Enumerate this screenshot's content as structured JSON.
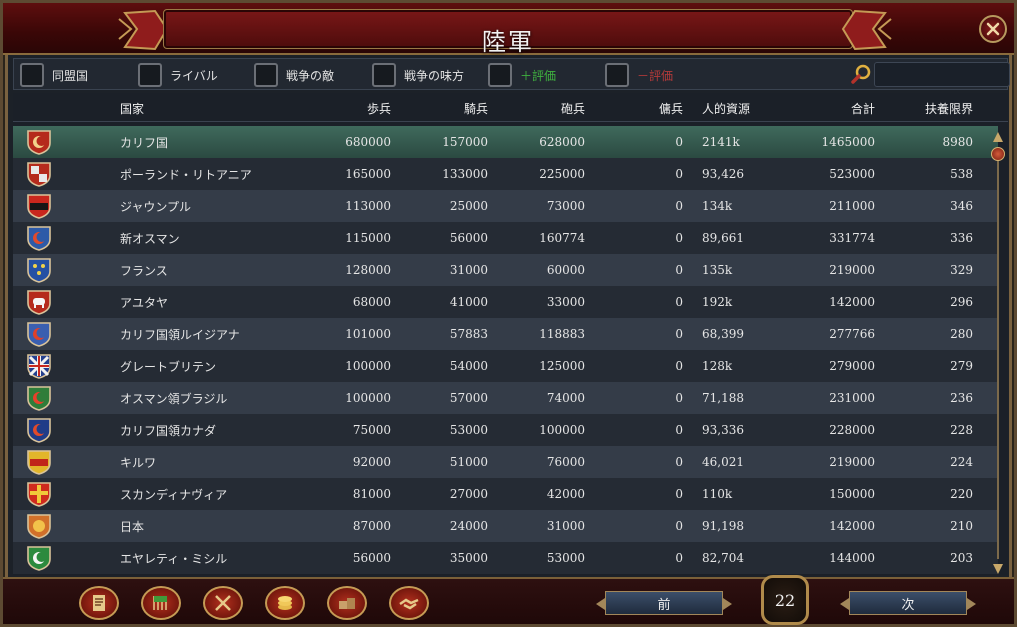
{
  "window": {
    "title": "陸軍"
  },
  "filters": [
    {
      "label": "同盟国",
      "tone": "normal"
    },
    {
      "label": "ライバル",
      "tone": "normal"
    },
    {
      "label": "戦争の敵",
      "tone": "normal"
    },
    {
      "label": "戦争の味方",
      "tone": "normal"
    },
    {
      "label": "＋評価",
      "tone": "plus"
    },
    {
      "label": "－評価",
      "tone": "minus"
    }
  ],
  "search": {
    "value": "",
    "placeholder": ""
  },
  "table": {
    "headers": {
      "country": "国家",
      "infantry": "歩兵",
      "cavalry": "騎兵",
      "artillery": "砲兵",
      "mercenaries": "傭兵",
      "manpower": "人的資源",
      "total": "合計",
      "force_limit": "扶養限界"
    },
    "rows": [
      {
        "country": "カリフ国",
        "infantry": "680000",
        "cavalry": "157000",
        "artillery": "628000",
        "mercenaries": "0",
        "manpower": "2141k",
        "total": "1465000",
        "force_limit": "8980",
        "shield": "crescent-red",
        "selected": true
      },
      {
        "country": "ポーランド・リトアニア",
        "infantry": "165000",
        "cavalry": "133000",
        "artillery": "225000",
        "mercenaries": "0",
        "manpower": "93,426",
        "total": "523000",
        "force_limit": "538",
        "shield": "quartered-red",
        "selected": false
      },
      {
        "country": "ジャウンプル",
        "infantry": "113000",
        "cavalry": "25000",
        "artillery": "73000",
        "mercenaries": "0",
        "manpower": "134k",
        "total": "211000",
        "force_limit": "346",
        "shield": "red-black",
        "selected": false
      },
      {
        "country": "新オスマン",
        "infantry": "115000",
        "cavalry": "56000",
        "artillery": "160774",
        "mercenaries": "0",
        "manpower": "89,661",
        "total": "331774",
        "force_limit": "336",
        "shield": "crescent-blue",
        "selected": false
      },
      {
        "country": "フランス",
        "infantry": "128000",
        "cavalry": "31000",
        "artillery": "60000",
        "mercenaries": "0",
        "manpower": "135k",
        "total": "219000",
        "force_limit": "329",
        "shield": "fleur-blue",
        "selected": false
      },
      {
        "country": "アユタヤ",
        "infantry": "68000",
        "cavalry": "41000",
        "artillery": "33000",
        "mercenaries": "0",
        "manpower": "192k",
        "total": "142000",
        "force_limit": "296",
        "shield": "elephant-red",
        "selected": false
      },
      {
        "country": "カリフ国領ルイジアナ",
        "infantry": "101000",
        "cavalry": "57883",
        "artillery": "118883",
        "mercenaries": "0",
        "manpower": "68,399",
        "total": "277766",
        "force_limit": "280",
        "shield": "crescent-blue-red",
        "selected": false
      },
      {
        "country": "グレートブリテン",
        "infantry": "100000",
        "cavalry": "54000",
        "artillery": "125000",
        "mercenaries": "0",
        "manpower": "128k",
        "total": "279000",
        "force_limit": "279",
        "shield": "union-jack",
        "selected": false
      },
      {
        "country": "オスマン領ブラジル",
        "infantry": "100000",
        "cavalry": "57000",
        "artillery": "74000",
        "mercenaries": "0",
        "manpower": "71,188",
        "total": "231000",
        "force_limit": "236",
        "shield": "crescent-green",
        "selected": false
      },
      {
        "country": "カリフ国領カナダ",
        "infantry": "75000",
        "cavalry": "53000",
        "artillery": "100000",
        "mercenaries": "0",
        "manpower": "93,336",
        "total": "228000",
        "force_limit": "228",
        "shield": "crescent-blue-dark",
        "selected": false
      },
      {
        "country": "キルワ",
        "infantry": "92000",
        "cavalry": "51000",
        "artillery": "76000",
        "mercenaries": "0",
        "manpower": "46,021",
        "total": "219000",
        "force_limit": "224",
        "shield": "yellow-red",
        "selected": false
      },
      {
        "country": "スカンディナヴィア",
        "infantry": "81000",
        "cavalry": "27000",
        "artillery": "42000",
        "mercenaries": "0",
        "manpower": "110k",
        "total": "150000",
        "force_limit": "220",
        "shield": "cross-red-yellow",
        "selected": false
      },
      {
        "country": "日本",
        "infantry": "87000",
        "cavalry": "24000",
        "artillery": "31000",
        "mercenaries": "0",
        "manpower": "91,198",
        "total": "142000",
        "force_limit": "210",
        "shield": "sun-orange",
        "selected": false
      },
      {
        "country": "エヤレティ・ミシル",
        "infantry": "56000",
        "cavalry": "35000",
        "artillery": "53000",
        "mercenaries": "0",
        "manpower": "82,704",
        "total": "144000",
        "force_limit": "203",
        "shield": "crescent-white-green",
        "selected": false
      }
    ]
  },
  "footer": {
    "tools": [
      "ledger-icon",
      "flags-icon",
      "crossed-swords-icon",
      "coins-icon",
      "crates-icon",
      "handshake-icon"
    ],
    "prev_label": "前",
    "next_label": "次",
    "page": "22"
  }
}
